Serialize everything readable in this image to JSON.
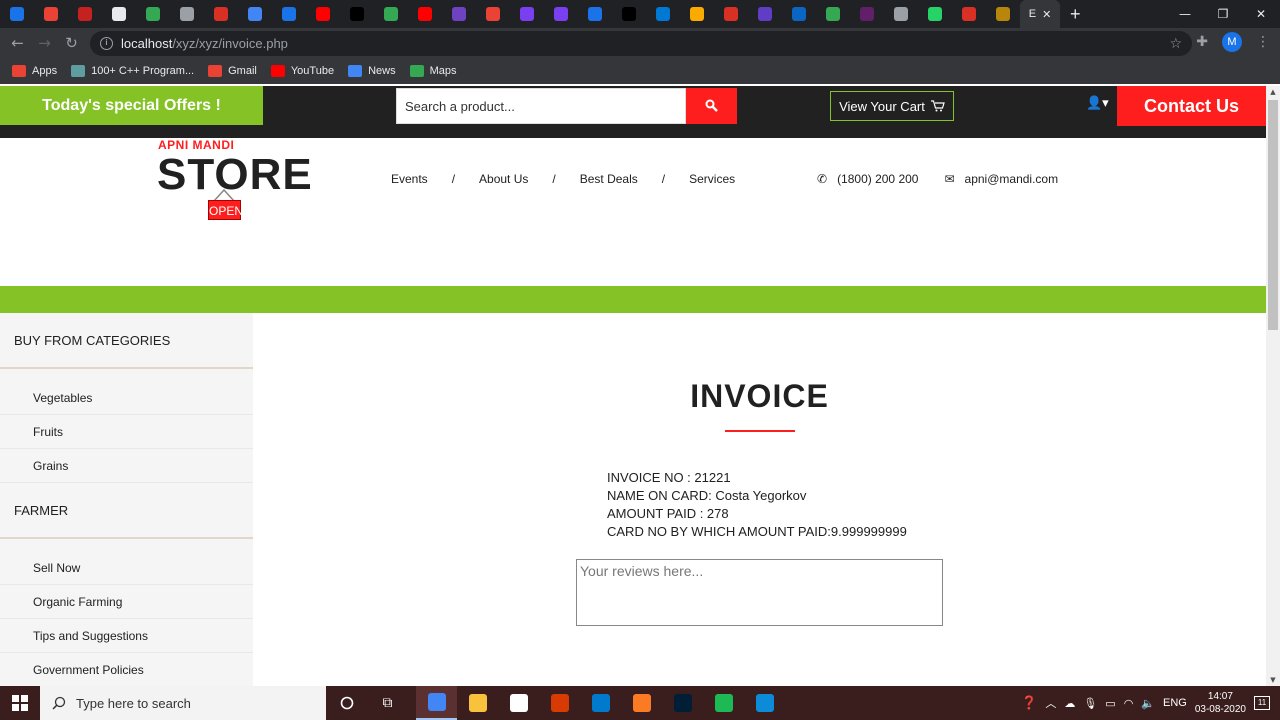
{
  "browser": {
    "tabs": [
      {
        "color": "#1a73e8"
      },
      {
        "color": "#ea4335"
      },
      {
        "color": "#c5221f"
      },
      {
        "color": "#e8eaed"
      },
      {
        "color": "#34a853"
      },
      {
        "color": "#9aa0a6"
      },
      {
        "color": "#d93025"
      },
      {
        "color": "#4285f4"
      },
      {
        "color": "#1a73e8"
      },
      {
        "color": "#ff0000"
      },
      {
        "color": "#000000"
      },
      {
        "color": "#34a853"
      },
      {
        "color": "#ff0000"
      },
      {
        "color": "#6f42c1"
      },
      {
        "color": "#ea4335"
      },
      {
        "color": "#7b3ff2"
      },
      {
        "color": "#7b3ff2"
      },
      {
        "color": "#1a73e8"
      },
      {
        "color": "#000000"
      },
      {
        "color": "#0078d4"
      },
      {
        "color": "#f9ab00"
      },
      {
        "color": "#d93025"
      },
      {
        "color": "#5f3dc4"
      },
      {
        "color": "#0a66c2"
      },
      {
        "color": "#34a853"
      },
      {
        "color": "#611f69"
      },
      {
        "color": "#9aa0a6"
      },
      {
        "color": "#25d366"
      },
      {
        "color": "#d93025"
      },
      {
        "color": "#b8860b"
      }
    ],
    "active_tab_label": "E",
    "new_tab": "+",
    "url_host": "localhost",
    "url_path": "/xyz/xyz/invoice.php",
    "profile_initial": "M",
    "bookmarks": [
      {
        "label": "Apps",
        "color": "#ea4335"
      },
      {
        "label": "100+ C++ Program...",
        "color": "#5f9ea0"
      },
      {
        "label": "Gmail",
        "color": "#ea4335"
      },
      {
        "label": "YouTube",
        "color": "#ff0000"
      },
      {
        "label": "News",
        "color": "#4285f4"
      },
      {
        "label": "Maps",
        "color": "#34a853"
      }
    ]
  },
  "site": {
    "offers": "Today's special Offers !",
    "search_placeholder": "Search a product...",
    "cart_label": "View Your Cart",
    "contact_label": "Contact Us",
    "logo_top": "APNI MANDI",
    "logo_main": "STORE",
    "logo_open": "OPEN",
    "nav": [
      "Events",
      "About Us",
      "Best Deals",
      "Services"
    ],
    "nav_sep": "/",
    "phone": "(1800) 200 200",
    "email": "apni@mandi.com",
    "brand_green": "#84c225",
    "brand_red": "#ff1e1e"
  },
  "sidebar": {
    "section1_title": "BUY FROM CATEGORIES",
    "section1_items": [
      "Vegetables",
      "Fruits",
      "Grains"
    ],
    "section2_title": "FARMER",
    "section2_items": [
      "Sell Now",
      "Organic Farming",
      "Tips and Suggestions",
      "Government Policies"
    ]
  },
  "invoice": {
    "title": "INVOICE",
    "invoice_no": "INVOICE NO : 21221",
    "name_on_card": "NAME ON CARD: Costa Yegorkov",
    "amount_paid": "AMOUNT PAID : 278",
    "card_no": "CARD NO BY WHICH AMOUNT PAID:9.999999999",
    "review_placeholder": "Your reviews here..."
  },
  "taskbar": {
    "search_placeholder": "Type here to search",
    "apps": [
      {
        "name": "chrome",
        "color": "#4285f4",
        "active": true
      },
      {
        "name": "file-explorer",
        "color": "#f9c23c",
        "active": false
      },
      {
        "name": "store",
        "color": "#ffffff",
        "active": false
      },
      {
        "name": "office",
        "color": "#d83b01",
        "active": false
      },
      {
        "name": "vscode",
        "color": "#007acc",
        "active": false
      },
      {
        "name": "xampp",
        "color": "#fb7a24",
        "active": false
      },
      {
        "name": "photoshop",
        "color": "#001e36",
        "active": false
      },
      {
        "name": "spotify",
        "color": "#1db954",
        "active": false
      },
      {
        "name": "edge",
        "color": "#0c8bd8",
        "active": false
      }
    ],
    "lang": "ENG",
    "time": "14:07",
    "date": "03-08-2020",
    "notif_count": "11"
  }
}
